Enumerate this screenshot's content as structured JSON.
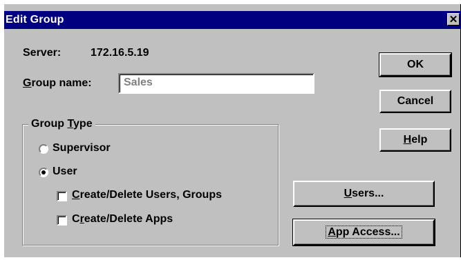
{
  "dialog": {
    "title": "Edit Group",
    "close_glyph": "✕"
  },
  "server": {
    "label": "Server:",
    "value": "172.16.5.19"
  },
  "group_name": {
    "label_mnemonic": "G",
    "label_rest": "roup name:",
    "value": "Sales"
  },
  "group_type": {
    "legend_prefix": "Group ",
    "legend_mnemonic": "T",
    "legend_rest": "ype",
    "selected": "User",
    "options": [
      {
        "label": "Supervisor",
        "checked": false
      },
      {
        "label": "User",
        "checked": true
      }
    ],
    "permissions": [
      {
        "mnemonic": "C",
        "rest": "reate/Delete Users, Groups",
        "checked": false
      },
      {
        "prefix": "C",
        "mnemonic": "r",
        "rest": "eate/Delete Apps",
        "checked": false
      }
    ]
  },
  "buttons": {
    "ok": "OK",
    "cancel": "Cancel",
    "help_mnemonic": "H",
    "help_rest": "elp",
    "users_mnemonic": "U",
    "users_rest": "sers...",
    "app_access_mnemonic": "A",
    "app_access_rest": "pp Access..."
  },
  "icons": [
    "close-icon",
    "radio-button-icon",
    "checkbox-icon"
  ]
}
